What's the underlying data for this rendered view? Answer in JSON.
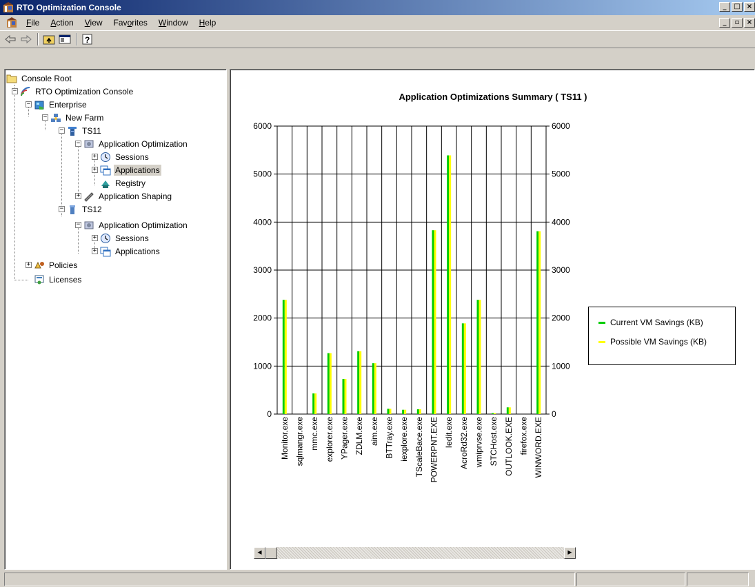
{
  "window": {
    "title": "RTO Optimization Console",
    "controls": [
      "_",
      "□",
      "×"
    ],
    "mdi_controls": [
      "_",
      "▫",
      "×"
    ]
  },
  "menu": {
    "items": [
      {
        "label": "File",
        "accel": "F"
      },
      {
        "label": "Action",
        "accel": "A"
      },
      {
        "label": "View",
        "accel": "V"
      },
      {
        "label": "Favorites",
        "accel": "o"
      },
      {
        "label": "Window",
        "accel": "W"
      },
      {
        "label": "Help",
        "accel": "H"
      }
    ]
  },
  "toolbar": {
    "buttons": [
      "back-arrow-icon",
      "forward-arrow-icon",
      "up-folder-icon",
      "show-hide-tree-icon",
      "help-icon"
    ]
  },
  "tree": {
    "nodes": [
      {
        "label": "Console Root",
        "icon": "folder-icon",
        "expander": ""
      },
      {
        "label": "RTO Optimization Console",
        "icon": "console-icon",
        "expander": "−"
      },
      {
        "label": "Enterprise",
        "icon": "enterprise-icon",
        "expander": "−"
      },
      {
        "label": "New Farm",
        "icon": "farm-icon",
        "expander": "−"
      },
      {
        "label": "TS11",
        "icon": "server-icon",
        "expander": "−"
      },
      {
        "label": "Application Optimization",
        "icon": "app-optimization-icon",
        "expander": "−"
      },
      {
        "label": "Sessions",
        "icon": "sessions-icon",
        "expander": "+"
      },
      {
        "label": "Applications",
        "icon": "applications-icon",
        "expander": "+",
        "selected": true
      },
      {
        "label": "Registry",
        "icon": "registry-icon",
        "expander": ""
      },
      {
        "label": "Application Shaping",
        "icon": "app-shaping-icon",
        "expander": "+"
      },
      {
        "label": "TS12",
        "icon": "server-icon",
        "expander": "−"
      },
      {
        "label": "Application Optimization",
        "icon": "app-optimization-icon",
        "expander": "−"
      },
      {
        "label": "Sessions",
        "icon": "sessions-icon",
        "expander": "+"
      },
      {
        "label": "Applications",
        "icon": "applications-icon",
        "expander": "+"
      },
      {
        "label": "Policies",
        "icon": "policies-icon",
        "expander": "+"
      },
      {
        "label": "Licenses",
        "icon": "licenses-icon",
        "expander": ""
      }
    ]
  },
  "chart_data": {
    "type": "bar",
    "title": "Application Optimizations Summary ( TS11 )",
    "categories": [
      "Monitor.exe",
      "sqlmangr.exe",
      "mmc.exe",
      "explorer.exe",
      "YPager.exe",
      "ZDLM.exe",
      "aim.exe",
      "BTTray.exe",
      "iexplore.exe",
      "TScaleBace.exe",
      "POWERPNT.EXE",
      "Iedit.exe",
      "AcroRd32.exe",
      "wmiprvse.exe",
      "STCHost.exe",
      "OUTLOOK.EXE",
      "firefox.exe",
      "WINWORD.EXE"
    ],
    "series": [
      {
        "name": "Current VM Savings (KB)",
        "color": "#00cc00",
        "values": [
          2380,
          0,
          430,
          1270,
          730,
          1310,
          1060,
          110,
          90,
          100,
          3830,
          5390,
          1890,
          2380,
          20,
          140,
          0,
          3810
        ]
      },
      {
        "name": "Possible VM Savings (KB)",
        "color": "#ffff00",
        "values": [
          2380,
          0,
          430,
          1270,
          730,
          1310,
          1060,
          110,
          90,
          100,
          3830,
          5390,
          1890,
          2380,
          20,
          140,
          0,
          3810
        ]
      }
    ],
    "ylim": [
      0,
      6000
    ],
    "yticks": [
      0,
      1000,
      2000,
      3000,
      4000,
      5000,
      6000
    ],
    "grid": true,
    "legend": "right"
  },
  "statusbar": {
    "cells": [
      "",
      "",
      ""
    ]
  }
}
